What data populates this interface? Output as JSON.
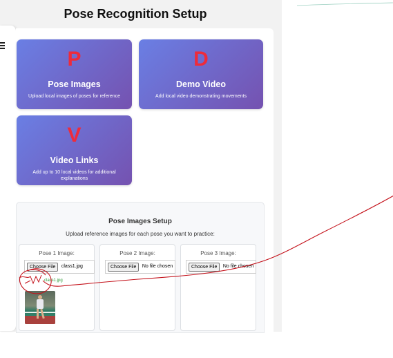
{
  "page_title": "Pose Recognition Setup",
  "cards": [
    {
      "letter": "P",
      "title": "Pose Images",
      "description": "Upload local images of poses for reference"
    },
    {
      "letter": "D",
      "title": "Demo Video",
      "description": "Add local video demonstrating movements"
    },
    {
      "letter": "V",
      "title": "Video Links",
      "description": "Add up to 10 local videos for additional explanations"
    }
  ],
  "setup": {
    "title": "Pose Images Setup",
    "subtitle": "Upload reference images for each pose you want to practice:",
    "poses": [
      {
        "label": "Pose 1 Image:",
        "button": "Choose File",
        "file": "class1.jpg",
        "status": "class1.jpg"
      },
      {
        "label": "Pose 2 Image:",
        "button": "Choose File",
        "file": "No file chosen"
      },
      {
        "label": "Pose 3 Image:",
        "button": "Choose File",
        "file": "No file chosen"
      }
    ]
  },
  "colors": {
    "card_gradient_start": "#6a7fe4",
    "card_gradient_end": "#7552b0",
    "letter_red": "#ee2b3b",
    "annotation_red": "#c4121b",
    "status_green": "#2e9d3a"
  },
  "icons": {
    "menu": "hamburger-icon"
  }
}
